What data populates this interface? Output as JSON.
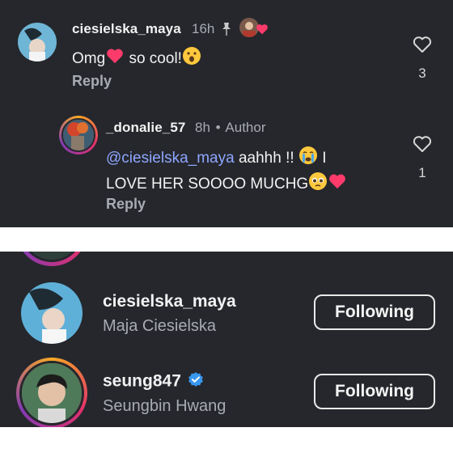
{
  "comments": [
    {
      "username": "ciesielska_maya",
      "time": "16h",
      "text_before": "Omg",
      "text_after": " so cool!",
      "reply_label": "Reply",
      "like_count": "3",
      "icons": [
        "pin-icon",
        "heart-icon",
        "astonished-face-emoji"
      ]
    },
    {
      "username": "_donalie_57",
      "time": "8h",
      "separator": "•",
      "author_badge": "Author",
      "mention": "@ciesielska_maya",
      "text_line1": " aahhh !!",
      "text_line1_tail": " I",
      "text_line2": "LOVE HER SOOOO MUCHG",
      "reply_label": "Reply",
      "like_count": "1",
      "icons": [
        "crying-face-emoji",
        "pleading-face-emoji",
        "heart-icon"
      ]
    }
  ],
  "accounts": [
    {
      "username": "ciesielska_maya",
      "full_name": "Maja Ciesielska",
      "button_label": "Following",
      "verified": false
    },
    {
      "username": "seung847",
      "full_name": "Seungbin Hwang",
      "button_label": "Following",
      "verified": true
    }
  ],
  "colors": {
    "background": "#25272c",
    "mention": "#8fa6ff",
    "heart": "#ff3b6b",
    "verified": "#3897f0",
    "story_ring": [
      "#f9a825",
      "#e1306c",
      "#833ab4"
    ]
  }
}
